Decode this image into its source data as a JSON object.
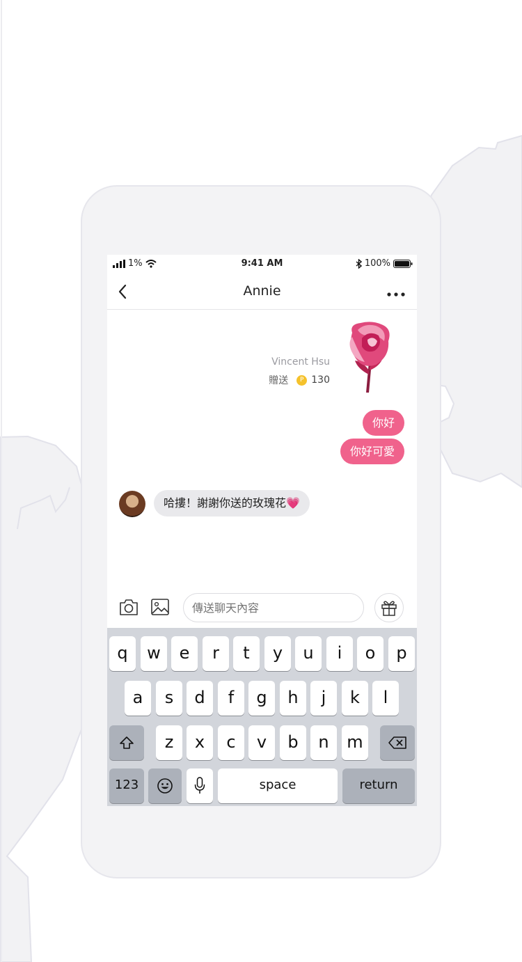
{
  "status_bar": {
    "carrier_signal": "1%",
    "time": "9:41 AM",
    "battery": "100%"
  },
  "nav": {
    "title": "Annie"
  },
  "gift": {
    "sender": "Vincent Hsu",
    "action_label": "贈送",
    "coin_symbol": "P",
    "amount": "130"
  },
  "messages": {
    "outgoing": [
      {
        "text": "你好"
      },
      {
        "text": "你好可愛"
      }
    ],
    "incoming": [
      {
        "text": "哈摟！謝謝你送的玫瑰花💗"
      }
    ]
  },
  "input": {
    "placeholder": "傳送聊天內容"
  },
  "keyboard": {
    "row1": [
      "q",
      "w",
      "e",
      "r",
      "t",
      "y",
      "u",
      "i",
      "o",
      "p"
    ],
    "row2": [
      "a",
      "s",
      "d",
      "f",
      "g",
      "h",
      "j",
      "k",
      "l"
    ],
    "row3": [
      "z",
      "x",
      "c",
      "v",
      "b",
      "n",
      "m"
    ],
    "numbers_label": "123",
    "space_label": "space",
    "return_label": "return"
  },
  "colors": {
    "accent": "#f0628c",
    "coin": "#f5c22c",
    "keyboard_bg": "#d2d5db"
  },
  "icons": [
    "back-icon",
    "more-icon",
    "camera-icon",
    "image-icon",
    "gift-icon",
    "shift-icon",
    "backspace-icon",
    "emoji-icon",
    "mic-icon",
    "signal-icon",
    "wifi-icon",
    "bluetooth-icon",
    "battery-icon"
  ]
}
